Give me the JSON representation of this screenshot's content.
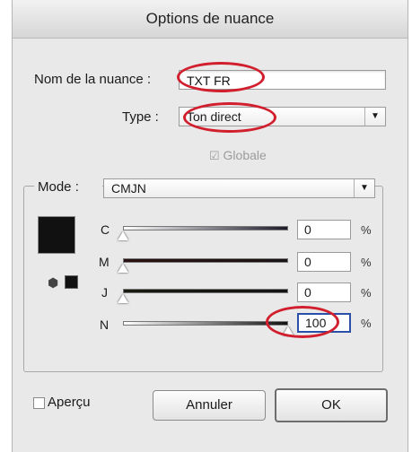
{
  "dialog": {
    "title": "Options de nuance",
    "name_label": "Nom de la nuance :",
    "name_value": "TXT FR",
    "type_label": "Type :",
    "type_value": "Ton direct",
    "global_label": "Globale",
    "mode_label": "Mode :",
    "mode_value": "CMJN",
    "preview_label": "Aperçu",
    "cancel_label": "Annuler",
    "ok_label": "OK"
  },
  "sliders": [
    {
      "label": "C",
      "value": "0",
      "unit": "%",
      "fraction": 0,
      "color": "#111111"
    },
    {
      "label": "M",
      "value": "0",
      "unit": "%",
      "fraction": 0,
      "color": "#111111"
    },
    {
      "label": "J",
      "value": "0",
      "unit": "%",
      "fraction": 0,
      "color": "#111111"
    },
    {
      "label": "N",
      "value": "100",
      "unit": "%",
      "fraction": 1,
      "color": "#111111"
    }
  ],
  "colors": {
    "swatch": "#111111",
    "highlight_circle": "#d21f2d",
    "focus_border": "#2a4fa8"
  }
}
